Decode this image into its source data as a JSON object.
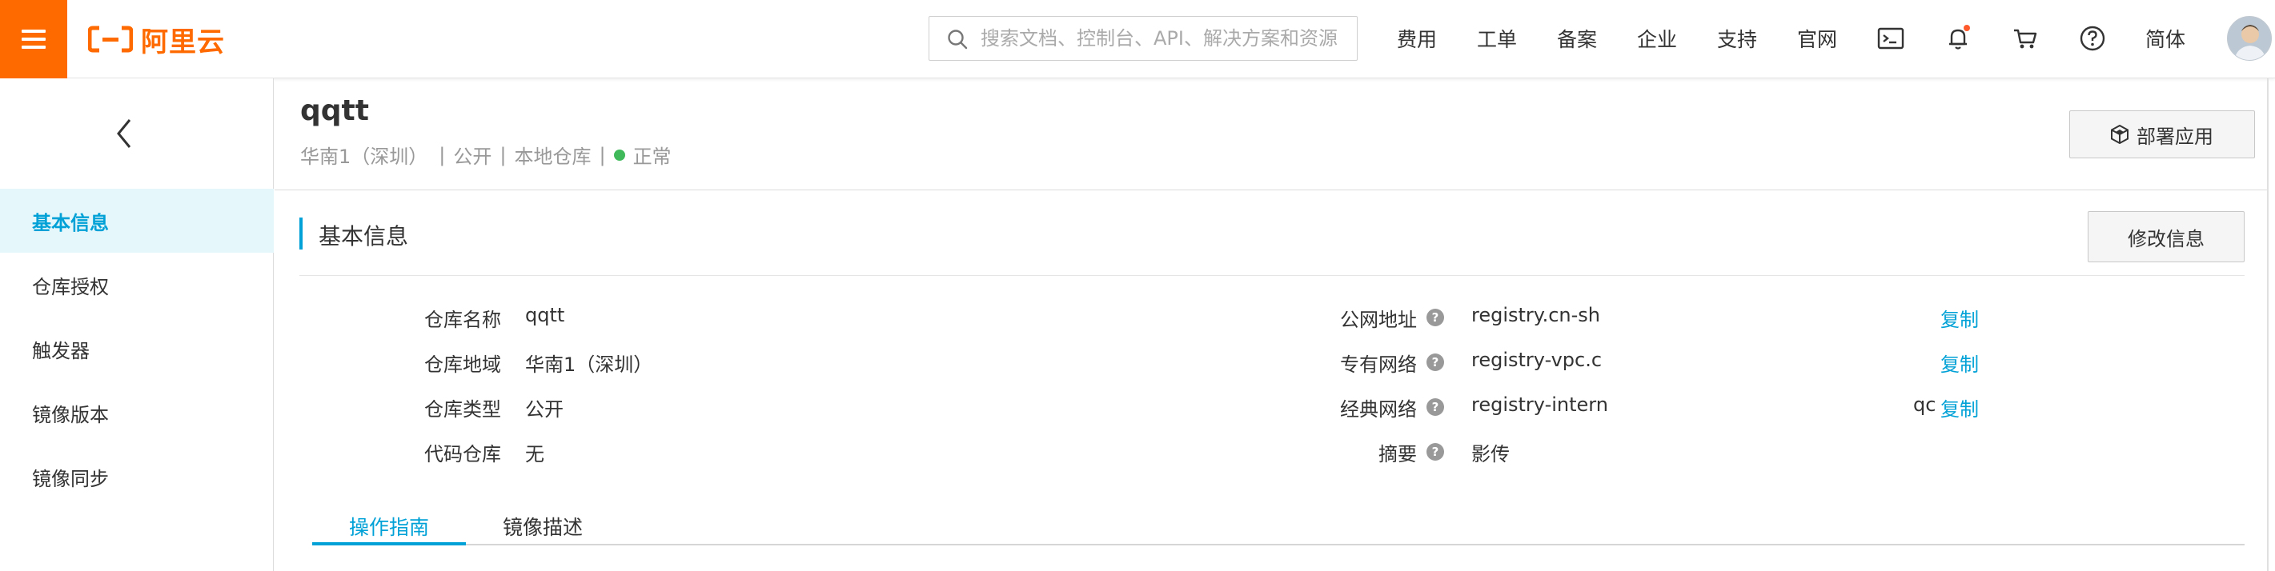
{
  "topbar": {
    "brand": "阿里云",
    "search_placeholder": "搜索文档、控制台、API、解决方案和资源",
    "nav": {
      "billing": "费用",
      "tickets": "工单",
      "icp": "备案",
      "enterprise": "企业",
      "support": "支持",
      "official_site": "官网",
      "language": "简体"
    },
    "icons": [
      "terminal-icon",
      "bell-icon",
      "cart-icon",
      "help-circle-icon"
    ],
    "accent_color": "#ff6a00"
  },
  "sidebar": {
    "items": [
      {
        "label": "基本信息",
        "active": true
      },
      {
        "label": "仓库授权",
        "active": false
      },
      {
        "label": "触发器",
        "active": false
      },
      {
        "label": "镜像版本",
        "active": false
      },
      {
        "label": "镜像同步",
        "active": false
      }
    ]
  },
  "header": {
    "repo_name": "qqtt",
    "region": "华南1（深圳）",
    "visibility": "公开",
    "repo_kind": "本地仓库",
    "status": "正常",
    "status_color": "#3fb95a",
    "separator": "|",
    "deploy_label": "部署应用"
  },
  "basic_info": {
    "title": "基本信息",
    "edit_label": "修改信息",
    "left": [
      {
        "label": "仓库名称",
        "value": "qqtt"
      },
      {
        "label": "仓库地域",
        "value": "华南1（深圳）"
      },
      {
        "label": "仓库类型",
        "value": "公开"
      },
      {
        "label": "代码仓库",
        "value": "无"
      }
    ],
    "right": [
      {
        "label": "公网地址",
        "value": "registry.cn-sh",
        "tail": "",
        "copy": "复制"
      },
      {
        "label": "专有网络",
        "value": "registry-vpc.c",
        "tail": "",
        "copy": "复制"
      },
      {
        "label": "经典网络",
        "value": "registry-intern",
        "tail": "qc",
        "copy": "复制"
      },
      {
        "label": "摘要",
        "value": "影传",
        "tail": "",
        "copy": ""
      }
    ],
    "help_glyph": "?"
  },
  "tabs": [
    {
      "label": "操作指南",
      "active": true
    },
    {
      "label": "镜像描述",
      "active": false
    }
  ],
  "link_color": "#00a1d6"
}
